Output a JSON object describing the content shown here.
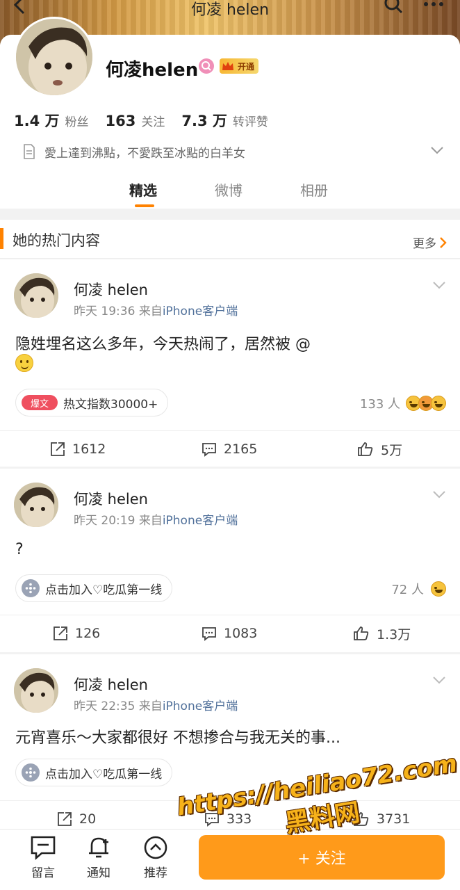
{
  "topbar": {
    "title": "何凌 helen"
  },
  "profile": {
    "name": "何凌helen",
    "vip_label": "开通",
    "stats": [
      {
        "num": "1.4 万",
        "label": "粉丝"
      },
      {
        "num": "163",
        "label": "关注"
      },
      {
        "num": "7.3 万",
        "label": "转评赞"
      }
    ],
    "bio": "愛上達到沸點，不愛跌至冰點的白羊女",
    "tabs": [
      "精选",
      "微博",
      "相册"
    ],
    "active_tab": "精选"
  },
  "hot": {
    "title": "她的热门内容",
    "more": "更多"
  },
  "posts": [
    {
      "name": "何凌 helen",
      "time": "昨天 19:36",
      "from": "来自",
      "source": "iPhone客户端",
      "text": "隐姓埋名这么多年，今天热闹了，居然被 @",
      "pill_tag": "爆文",
      "pill_text": "热文指数30000+",
      "reactors": "133 人",
      "repost": "1612",
      "comment": "2165",
      "like": "5万"
    },
    {
      "name": "何凌 helen",
      "time": "昨天 20:19",
      "from": "来自",
      "source": "iPhone客户端",
      "text": "?",
      "pill_text": "点击加入♡吃瓜第一线",
      "reactors": "72 人",
      "repost": "126",
      "comment": "1083",
      "like": "1.3万"
    },
    {
      "name": "何凌 helen",
      "time": "昨天 22:35",
      "from": "来自",
      "source": "iPhone客户端",
      "text": "元宵喜乐～大家都很好 不想掺合与我无关的事...",
      "pill_text": "点击加入♡吃瓜第一线",
      "repost": "20",
      "comment": "333",
      "like": "3731"
    }
  ],
  "bottombar": {
    "items": [
      "留言",
      "通知",
      "推荐"
    ],
    "follow": "+ 关注"
  },
  "watermark": {
    "url": "https://heiliao72.com",
    "cn": "黑料网"
  },
  "colors": {
    "accent": "#ff8200",
    "link": "#50709a",
    "follow_bg": "#ff9a1a"
  }
}
